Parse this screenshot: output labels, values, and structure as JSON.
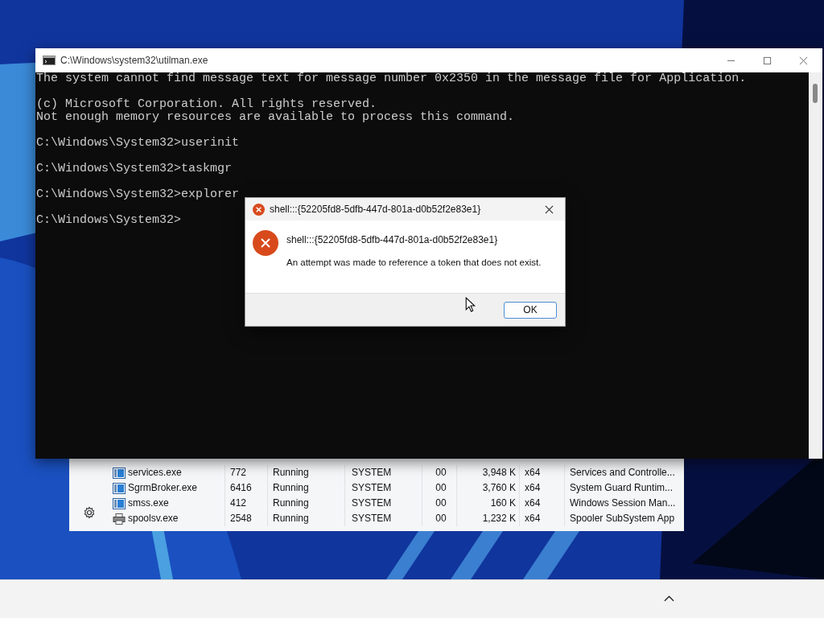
{
  "console": {
    "title": "C:\\Windows\\system32\\utilman.exe",
    "paragraphs": [
      {
        "lines": [
          "The system cannot find message text for message number 0x2350 in the message file for Application."
        ]
      },
      {
        "lines": [
          "(c) Microsoft Corporation. All rights reserved.",
          "Not enough memory resources are available to process this command."
        ]
      },
      {
        "lines": [
          "C:\\Windows\\System32>userinit"
        ]
      },
      {
        "lines": [
          "C:\\Windows\\System32>taskmgr"
        ]
      },
      {
        "lines": [
          "C:\\Windows\\System32>explorer"
        ]
      },
      {
        "lines": [
          "C:\\Windows\\System32>"
        ]
      }
    ]
  },
  "task_manager": {
    "rows": [
      {
        "name": "services.exe",
        "kind": "service",
        "pid": "772",
        "status": "Running",
        "user": "SYSTEM",
        "cpu": "00",
        "memory": "3,948 K",
        "arch": "x64",
        "description": "Services and Controlle..."
      },
      {
        "name": "SgrmBroker.exe",
        "kind": "service",
        "pid": "6416",
        "status": "Running",
        "user": "SYSTEM",
        "cpu": "00",
        "memory": "3,760 K",
        "arch": "x64",
        "description": "System Guard Runtim..."
      },
      {
        "name": "smss.exe",
        "kind": "service",
        "pid": "412",
        "status": "Running",
        "user": "SYSTEM",
        "cpu": "00",
        "memory": "160 K",
        "arch": "x64",
        "description": "Windows Session Man..."
      },
      {
        "name": "spoolsv.exe",
        "kind": "printer",
        "pid": "2548",
        "status": "Running",
        "user": "SYSTEM",
        "cpu": "00",
        "memory": "1,232 K",
        "arch": "x64",
        "description": "Spooler SubSystem App"
      }
    ]
  },
  "dialog": {
    "title": "shell:::{52205fd8-5dfb-447d-801a-d0b52f2e83e1}",
    "heading": "shell:::{52205fd8-5dfb-447d-801a-d0b52f2e83e1}",
    "message": "An attempt was made to reference a token that does not exist.",
    "buttons": [
      "OK"
    ]
  }
}
